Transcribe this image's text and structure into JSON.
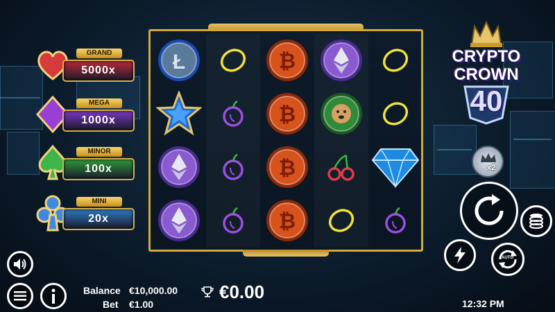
{
  "jackpots": [
    {
      "name": "GRAND",
      "value": "5000x",
      "color": "#d63a3a",
      "box_bg": "#b8293a",
      "suit": "heart"
    },
    {
      "name": "MEGA",
      "value": "1000x",
      "color": "#9a3fd6",
      "box_bg": "#7a38c4",
      "suit": "diamond"
    },
    {
      "name": "MINOR",
      "value": "100x",
      "color": "#3fb64a",
      "box_bg": "#2f9a3a",
      "suit": "spade"
    },
    {
      "name": "MINI",
      "value": "20x",
      "color": "#3f8ae0",
      "box_bg": "#2d7ac2",
      "suit": "club"
    }
  ],
  "logo": {
    "line1": "CRYPTO",
    "line2": "CROWN",
    "line3": "40"
  },
  "reels": [
    [
      "litecoin",
      "star",
      "ethereum",
      "ethereum"
    ],
    [
      "lemon",
      "plum",
      "plum",
      "plum"
    ],
    [
      "bitcoin",
      "bitcoin",
      "bitcoin",
      "bitcoin"
    ],
    [
      "ethereum",
      "dogecoin",
      "cherry",
      "lemon"
    ],
    [
      "lemon",
      "lemon",
      "diamond",
      "plum"
    ]
  ],
  "controls": {
    "multiplier_label": "x2",
    "auto_label": "AUTO"
  },
  "hud": {
    "balance_label": "Balance",
    "balance_value": "€10,000.00",
    "bet_label": "Bet",
    "bet_value": "€1.00",
    "win_value": "€0.00",
    "clock": "12:32 PM"
  },
  "colors": {
    "gold": "#d4a93a",
    "lemon": "#f2e23a",
    "plum": "#9b4fe0",
    "cherry": "#e03a4a"
  }
}
